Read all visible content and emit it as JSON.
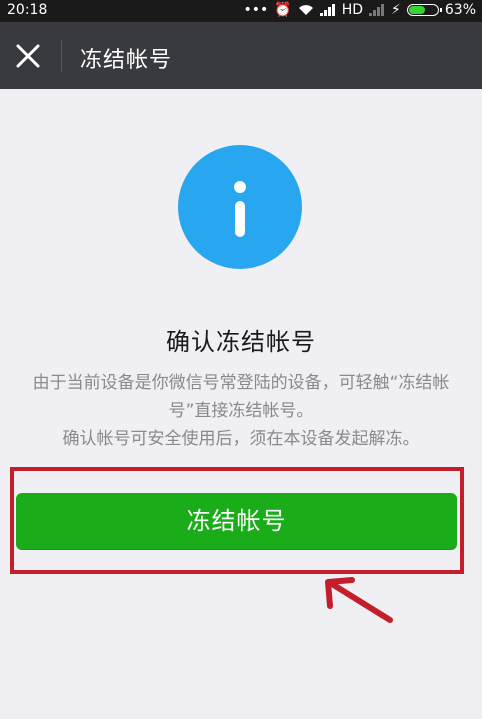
{
  "status_bar": {
    "time": "20:18",
    "network_label": "HD",
    "battery": "63%",
    "battery_level": 0.63
  },
  "title_bar": {
    "title": "冻结帐号"
  },
  "content": {
    "heading": "确认冻结帐号",
    "description_line1": "由于当前设备是你微信号常登陆的设备，可轻触“冻结帐号”直接冻结帐号。",
    "description_line2": "确认帐号可安全使用后，须在本设备发起解冻。"
  },
  "action": {
    "button_label": "冻结帐号"
  },
  "colors": {
    "accent_green": "#1aad19",
    "info_blue": "#28a6ef",
    "annotation_red": "#c41e2a"
  }
}
